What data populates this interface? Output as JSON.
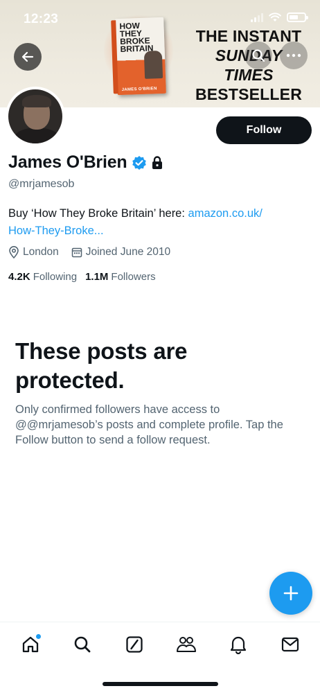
{
  "status_bar": {
    "time": "12:23"
  },
  "banner": {
    "book": {
      "title_lines": [
        "HOW",
        "THEY",
        "BROKE",
        "BRITAIN"
      ],
      "author": "JAMES O'BRIEN"
    },
    "promo_lines": [
      "THE INSTANT",
      "SUNDAY TIMES",
      "BESTSELLER"
    ]
  },
  "header": {
    "back_icon": "arrow-left-icon",
    "search_icon": "search-icon",
    "more_icon": "more-icon"
  },
  "profile": {
    "name": "James O'Brien",
    "handle": "@mrjamesob",
    "verified_icon": "verified-badge-icon",
    "protected_icon": "lock-icon",
    "follow_label": "Follow",
    "bio_text": "Buy ‘How They Broke Britain’ here: ",
    "bio_link_1": "amazon.co.uk/",
    "bio_link_2": "How-They-Broke...",
    "location": "London",
    "joined": "Joined June 2010",
    "following_count": "4.2K",
    "following_label": "Following",
    "followers_count": "1.1M",
    "followers_label": "Followers"
  },
  "protected": {
    "title": "These posts are protected.",
    "description": "Only confirmed followers have access to @@mrjamesob’s posts and complete profile. Tap the Follow button to send a follow request."
  },
  "fab": {
    "icon": "plus-icon"
  },
  "nav": {
    "items": [
      {
        "icon": "home-icon",
        "has_dot": true
      },
      {
        "icon": "search-icon"
      },
      {
        "icon": "grok-icon"
      },
      {
        "icon": "communities-icon"
      },
      {
        "icon": "notifications-icon"
      },
      {
        "icon": "messages-icon"
      }
    ]
  },
  "colors": {
    "accent": "#1d9bf0",
    "text_primary": "#0f1419",
    "text_secondary": "#536471",
    "button_dark": "#0f1419"
  }
}
